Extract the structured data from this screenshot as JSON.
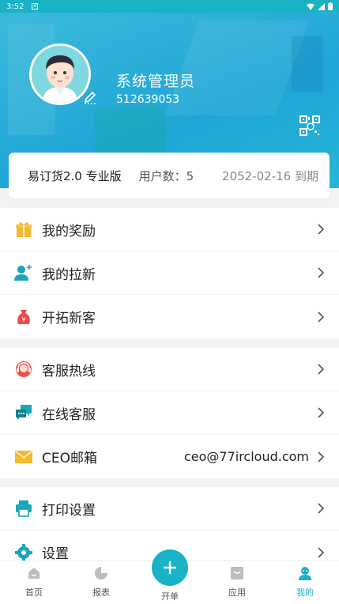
{
  "status_bar": {
    "time": "3:52",
    "notif_icon": "A"
  },
  "profile": {
    "name": "系统管理员",
    "id": "512639053"
  },
  "info_card": {
    "edition": "易订货2.0 专业版",
    "users": "用户数：5",
    "expire": "2052-02-16 到期"
  },
  "menu_group_1": [
    {
      "label": "我的奖励",
      "icon": "gift-icon"
    },
    {
      "label": "我的拉新",
      "icon": "user-add-icon"
    },
    {
      "label": "开拓新客",
      "icon": "money-bag-icon"
    }
  ],
  "menu_group_2": [
    {
      "label": "客服热线",
      "icon": "headset-icon"
    },
    {
      "label": "在线客服",
      "icon": "chat-icon"
    },
    {
      "label": "CEO邮箱",
      "icon": "mail-icon",
      "value": "ceo@77ircloud.com"
    }
  ],
  "menu_group_3": [
    {
      "label": "打印设置",
      "icon": "printer-icon"
    },
    {
      "label": "设置",
      "icon": "gear-icon"
    }
  ],
  "tabbar": {
    "home": "首页",
    "reports": "报表",
    "create": "开单",
    "apps": "应用",
    "mine": "我的"
  },
  "colors": {
    "accent": "#19b3c6",
    "header": "#1fa6d6"
  }
}
